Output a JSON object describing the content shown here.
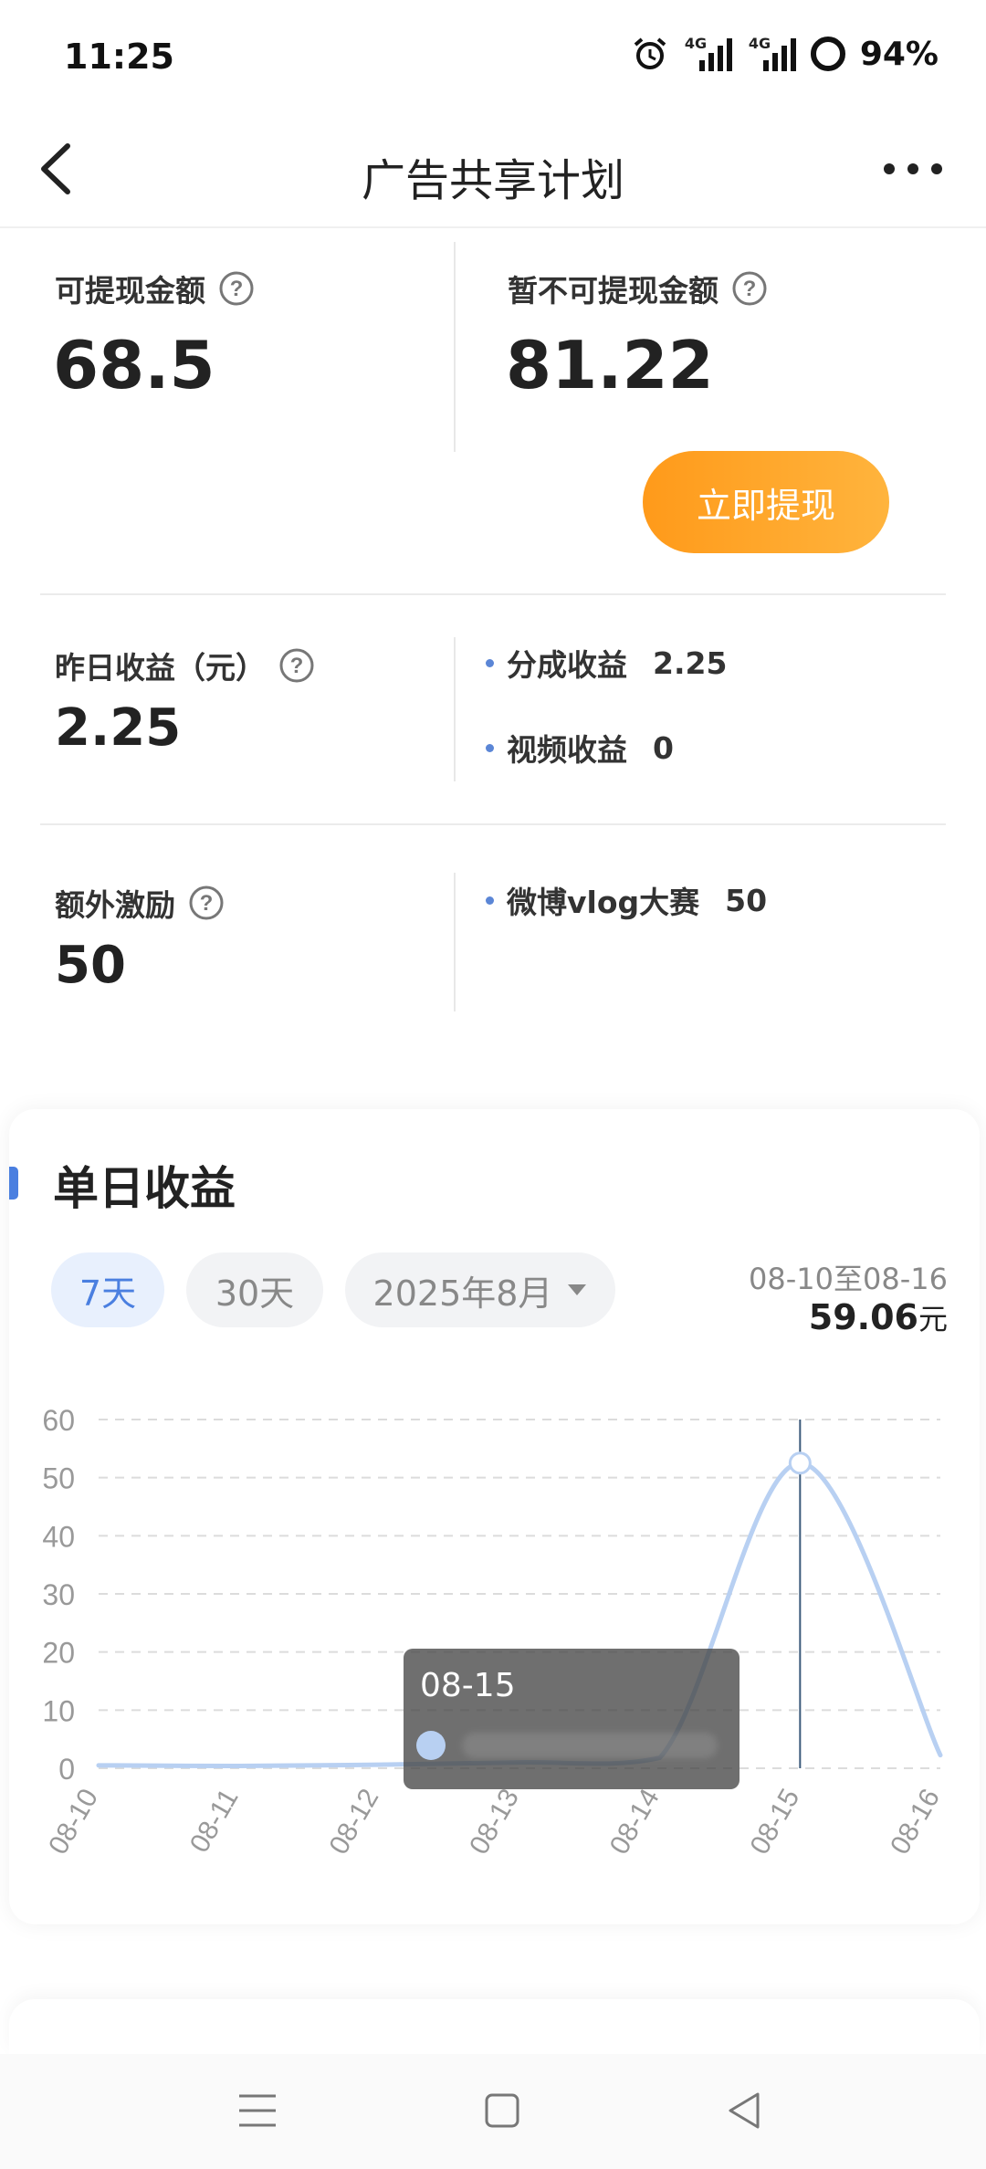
{
  "status": {
    "time": "11:25",
    "battery": "94%",
    "signal_tag_1": "4G",
    "signal_tag_2": "4G"
  },
  "nav": {
    "title": "广告共享计划"
  },
  "balance": {
    "withdrawable_label": "可提现金额",
    "withdrawable_value": "68.5",
    "pending_label": "暂不可提现金额",
    "pending_value": "81.22",
    "withdraw_button": "立即提现"
  },
  "yesterday": {
    "label": "昨日收益（元）",
    "value": "2.25",
    "items": [
      {
        "label": "分成收益",
        "value": "2.25"
      },
      {
        "label": "视频收益",
        "value": "0"
      }
    ]
  },
  "bonus": {
    "label": "额外激励",
    "value": "50",
    "items": [
      {
        "label": "微博vlog大赛",
        "value": "50"
      }
    ]
  },
  "daily": {
    "title": "单日收益",
    "tabs": [
      {
        "label": "7天",
        "active": true
      },
      {
        "label": "30天",
        "active": false
      }
    ],
    "month_select": "2025年8月",
    "range": "08-10至08-16",
    "total": "59.06",
    "total_unit": "元",
    "tooltip_date": "08-15"
  },
  "chart_data": {
    "type": "line",
    "x": [
      "08-10",
      "08-11",
      "08-12",
      "08-13",
      "08-14",
      "08-15",
      "08-16"
    ],
    "series": [
      {
        "values": [
          0.5,
          0.4,
          0.6,
          1.0,
          1.8,
          52.5,
          2.25
        ]
      }
    ],
    "ylim": [
      0,
      60
    ],
    "yticks": [
      0,
      10,
      20,
      30,
      40,
      50,
      60
    ],
    "grid": true,
    "highlight_index": 5,
    "line_color": "#b8d0f2",
    "accent_color": "#4a7fe0"
  }
}
